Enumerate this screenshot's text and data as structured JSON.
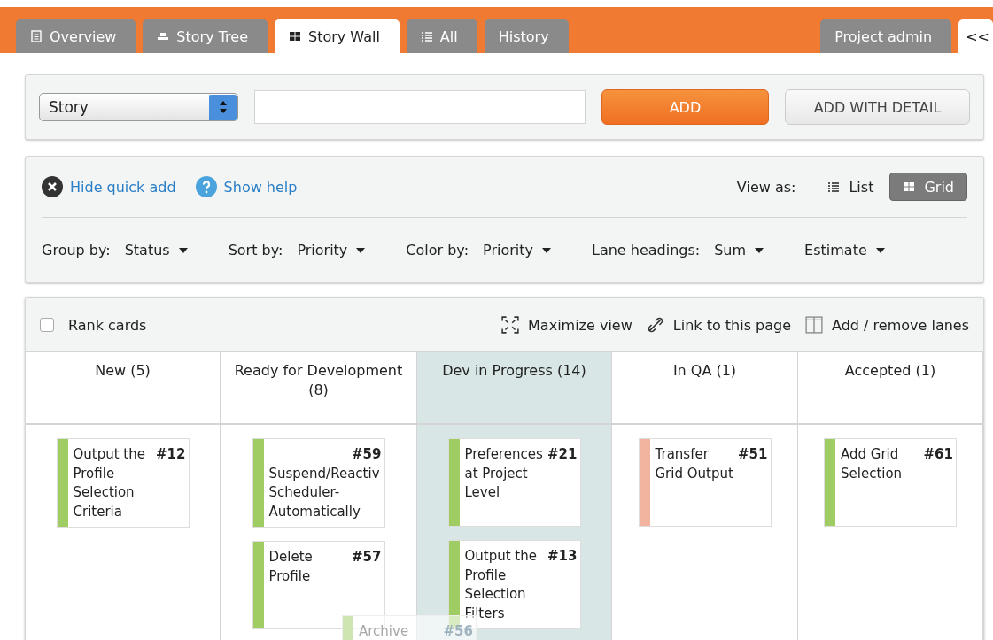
{
  "tabs": [
    {
      "label": "Overview",
      "selected": false
    },
    {
      "label": "Story Tree",
      "selected": false
    },
    {
      "label": "Story Wall",
      "selected": true
    },
    {
      "label": "All",
      "selected": false
    },
    {
      "label": "History",
      "selected": false
    }
  ],
  "right_tabs": [
    {
      "label": "Project admin",
      "selected": false
    },
    {
      "label": "<<",
      "selected": true
    }
  ],
  "quick_add": {
    "type_select": "Story",
    "add_button": "ADD",
    "add_detail_button": "ADD WITH DETAIL"
  },
  "options": {
    "hide_quick_add": "Hide quick add",
    "show_help": "Show help",
    "view_as_label": "View as:",
    "views": [
      {
        "label": "List",
        "selected": false
      },
      {
        "label": "Grid",
        "selected": true
      }
    ],
    "filters": [
      {
        "label": "Group by:",
        "value": "Status"
      },
      {
        "label": "Sort by:",
        "value": "Priority"
      },
      {
        "label": "Color by:",
        "value": "Priority"
      },
      {
        "label": "Lane headings:",
        "value": "Sum"
      },
      {
        "value": "Estimate"
      }
    ]
  },
  "board_toolbar": {
    "rank_cards": {
      "label": "Rank cards",
      "checked": false
    },
    "maximize": "Maximize view",
    "link": "Link to this page",
    "lanes": "Add / remove lanes"
  },
  "lanes": [
    {
      "title": "New (5)",
      "selected": false,
      "cards": [
        {
          "title": "Output the Profile Selection Criteria",
          "number": "#12",
          "color": "#a0cd63"
        }
      ]
    },
    {
      "title": "Ready for Development (8)",
      "selected": false,
      "cards": [
        {
          "title": "Suspend/Reactiv Scheduler-Automatically",
          "number": "#59",
          "color": "#a0cd63"
        },
        {
          "title": "Delete Profile",
          "number": "#57",
          "color": "#a0cd63"
        }
      ]
    },
    {
      "title": "Dev in Progress (14)",
      "selected": true,
      "cards": [
        {
          "title": "Preferences at Project Level",
          "number": "#21",
          "color": "#a0cd63"
        },
        {
          "title": "Output the Profile Selection Filters",
          "number": "#13",
          "color": "#a0cd63"
        }
      ]
    },
    {
      "title": "In QA (1)",
      "selected": false,
      "cards": [
        {
          "title": "Transfer Grid Output",
          "number": "#51",
          "color": "#f2b49f"
        }
      ]
    },
    {
      "title": "Accepted (1)",
      "selected": false,
      "cards": [
        {
          "title": "Add Grid Selection",
          "number": "#61",
          "color": "#a0cd63"
        }
      ]
    }
  ],
  "dragged_card": {
    "title": "Archive",
    "number": "#56",
    "color": "#cfe5b1"
  }
}
